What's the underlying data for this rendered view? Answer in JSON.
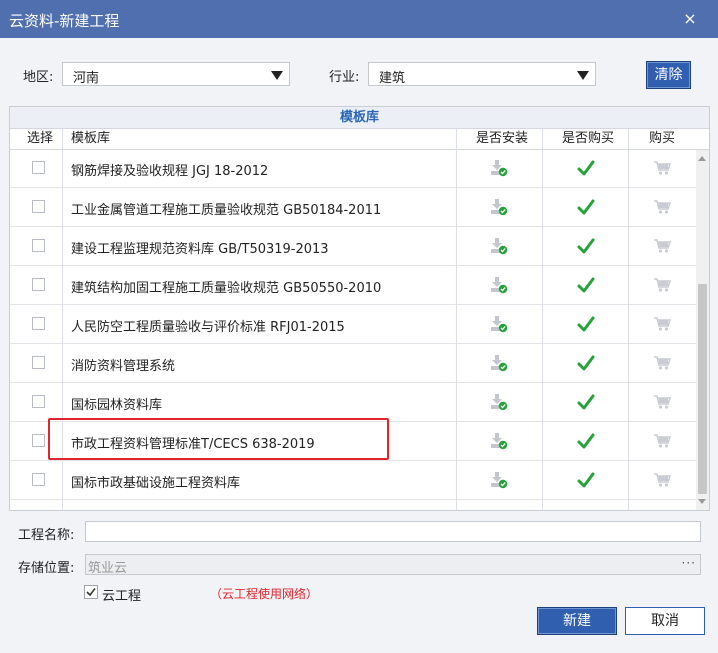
{
  "window": {
    "title": "云资料-新建工程",
    "close_glyph": "×"
  },
  "filters": {
    "region_label": "地区:",
    "region_value": "河南",
    "industry_label": "行业:",
    "industry_value": "建筑",
    "clear_label": "清除"
  },
  "table": {
    "title": "模板库",
    "headers": {
      "select": "选择",
      "template": "模板库",
      "installed": "是否安装",
      "purchased": "是否购买",
      "buy": "购买"
    },
    "rows": [
      {
        "name": "钢筋焊接及验收规程 JGJ 18-2012"
      },
      {
        "name": "工业金属管道工程施工质量验收规范 GB50184-2011"
      },
      {
        "name": "建设工程监理规范资料库 GB/T50319-2013"
      },
      {
        "name": "建筑结构加固工程施工质量验收规范 GB50550-2010"
      },
      {
        "name": "人民防空工程质量验收与评价标准 RFJ01-2015"
      },
      {
        "name": "消防资料管理系统"
      },
      {
        "name": "国标园林资料库"
      },
      {
        "name": "市政工程资料管理标准T/CECS 638-2019"
      },
      {
        "name": "国标市政基础设施工程资料库"
      }
    ]
  },
  "form": {
    "project_name_label": "工程名称:",
    "project_name_value": "",
    "storage_label": "存储位置:",
    "storage_value": "筑业云",
    "storage_browse": "···",
    "cloud_checkbox_label": "云工程",
    "cloud_checked": true,
    "cloud_note": "（云工程使用网络）"
  },
  "buttons": {
    "create": "新建",
    "cancel": "取消"
  },
  "colors": {
    "titlebar": "#4f6fae",
    "accent": "#2f5fae",
    "check_green": "#25a33a",
    "note_red": "#e0252c",
    "highlight": "#e0252c"
  }
}
